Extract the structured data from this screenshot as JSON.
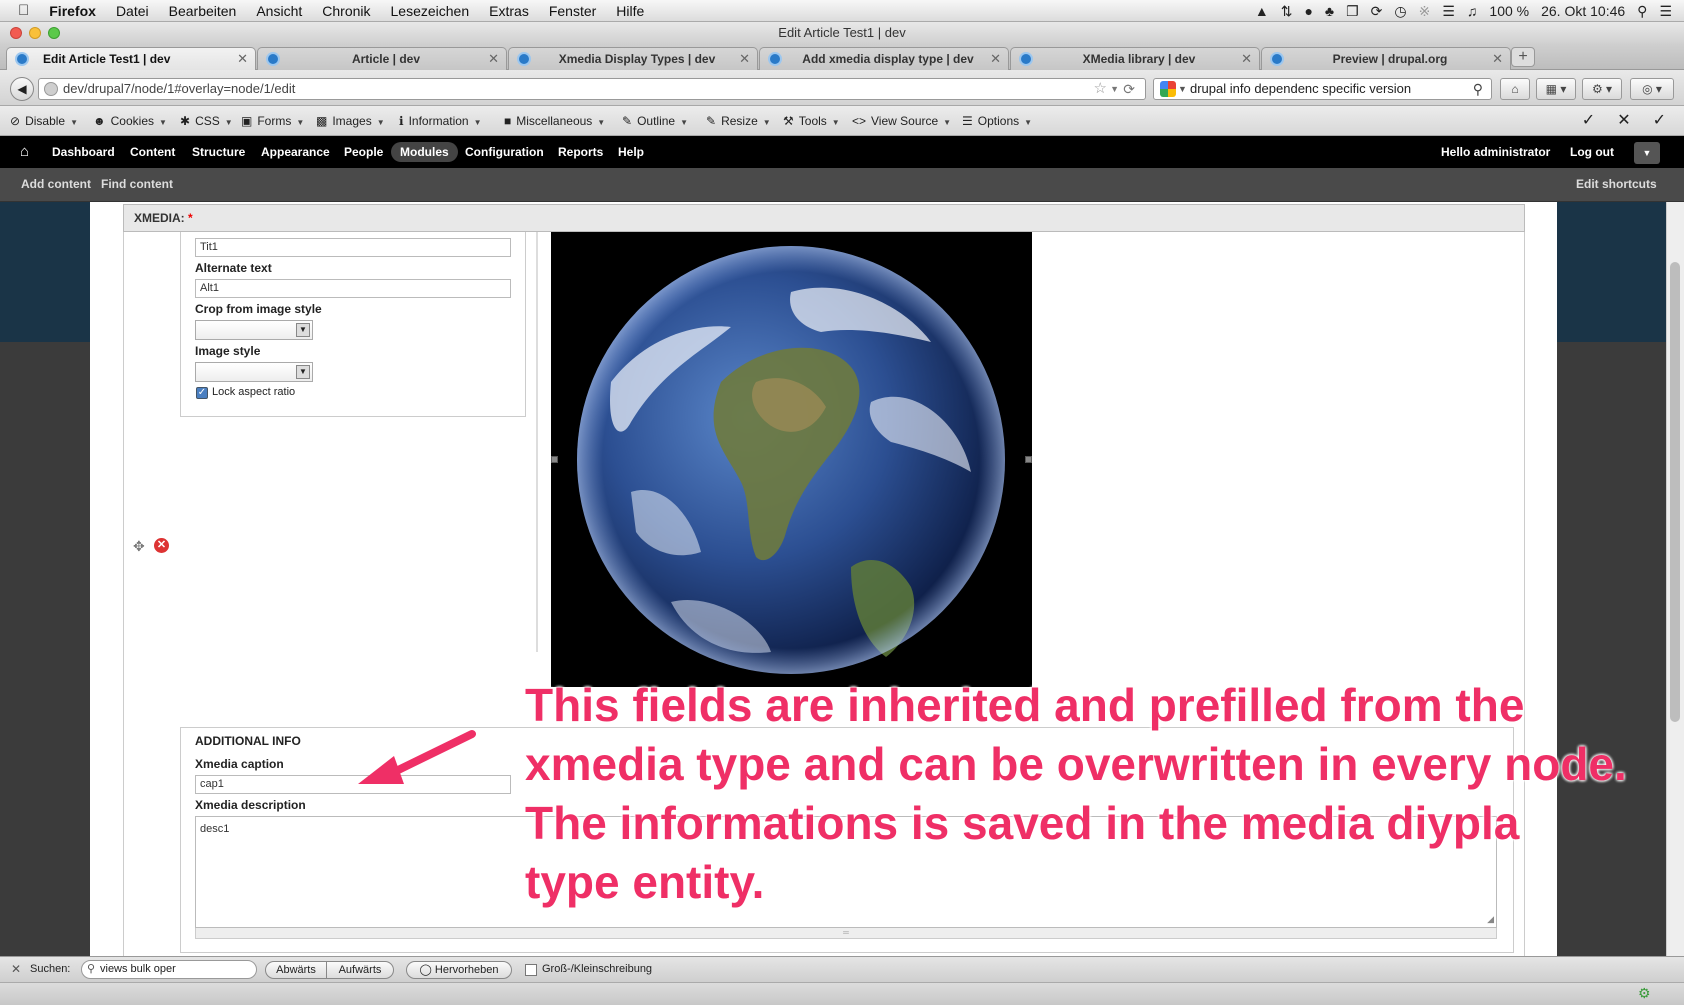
{
  "mac_menu": {
    "apple": "",
    "app": "Firefox",
    "items": [
      "Datei",
      "Bearbeiten",
      "Ansicht",
      "Chronik",
      "Lesezeichen",
      "Extras",
      "Fenster",
      "Hilfe"
    ],
    "battery": "100 %",
    "datetime": "26. Okt  10:46"
  },
  "window_title": "Edit Article Test1 | dev",
  "tabs": [
    {
      "label": "Edit Article Test1 | dev"
    },
    {
      "label": "Article | dev"
    },
    {
      "label": "Xmedia Display Types | dev"
    },
    {
      "label": "Add xmedia display type | dev"
    },
    {
      "label": "XMedia library | dev"
    },
    {
      "label": "Preview | drupal.org"
    }
  ],
  "url": "dev/drupal7/node/1#overlay=node/1/edit",
  "search_query": "drupal info dependenc specific version",
  "webdev_toolbar": [
    "Disable",
    "Cookies",
    "CSS",
    "Forms",
    "Images",
    "Information",
    "Miscellaneous",
    "Outline",
    "Resize",
    "Tools",
    "View Source",
    "Options"
  ],
  "drupal_toolbar": {
    "items": [
      "Dashboard",
      "Content",
      "Structure",
      "Appearance",
      "People",
      "Modules",
      "Configuration",
      "Reports",
      "Help"
    ],
    "hello_prefix": "Hello ",
    "user": "administrator",
    "logout": "Log out",
    "shortcuts": [
      "Add content",
      "Find content"
    ],
    "edit_shortcuts": "Edit shortcuts"
  },
  "form": {
    "legend": "XMEDIA:",
    "required_mark": "*",
    "title_value": "Tit1",
    "alt_label": "Alternate text",
    "alt_value": "Alt1",
    "crop_label": "Crop from image style",
    "style_label": "Image style",
    "lock_label": "Lock aspect ratio",
    "additional_heading": "ADDITIONAL INFO",
    "caption_label": "Xmedia caption",
    "caption_value": "cap1",
    "description_label": "Xmedia description",
    "description_value": "desc1"
  },
  "annotation": [
    "This fields are inherited and prefilled from the",
    "xmedia type and can be overwritten in every node.",
    "The informations is saved in the media diypla",
    "type entity."
  ],
  "findbar": {
    "label": "Suchen:",
    "query": "views bulk oper",
    "down": "Abwärts",
    "up": "Aufwärts",
    "highlight": "Hervorheben",
    "case": "Groß-/Kleinschreibung"
  },
  "colors": {
    "annotation": "#ef2f66",
    "drupal_toolbar": "#000000"
  }
}
